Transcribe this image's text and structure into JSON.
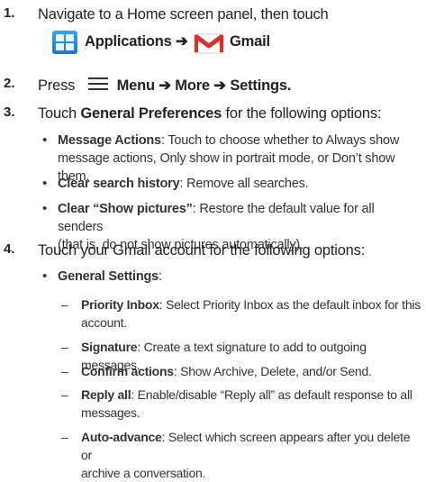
{
  "step1": {
    "num": "1.",
    "text": "Navigate to a Home screen panel, then touch",
    "applications": "Applications",
    "arrow": "➔",
    "gmail": "Gmail"
  },
  "step2": {
    "num": "2.",
    "press": "Press",
    "menu": "Menu",
    "arrow1": "➔",
    "more": "More",
    "arrow2": "➔",
    "settings": "Settings",
    "period": "."
  },
  "step3": {
    "num": "3.",
    "touch": "Touch",
    "general_preferences": "General Preferences",
    "rest": "for the following options:",
    "bullets": [
      {
        "title": "Message Actions",
        "text_l1": ": Touch to choose whether to Always show",
        "text_l2": "message actions, Only show in portrait mode, or Don’t show them."
      },
      {
        "title": "Clear search history",
        "text_l1": ": Remove all searches.",
        "text_l2": ""
      },
      {
        "title": "Clear “Show pictures”",
        "text_l1": ": Restore the default value for all senders",
        "text_l2": "(that is, do not show pictures automatically)."
      }
    ]
  },
  "step4": {
    "num": "4.",
    "text": "Touch your Gmail account for the following options:",
    "bullet": "General Settings",
    "colon": ":",
    "subs": [
      {
        "title": "Priority Inbox",
        "text_l1": ": Select Priority Inbox as the default inbox for this",
        "text_l2": "account."
      },
      {
        "title": "Signature",
        "text_l1": ": Create a text signature to add to outgoing messages.",
        "text_l2": ""
      },
      {
        "title": "Confirm actions",
        "text_l1": ": Show Archive, Delete, and/or Send.",
        "text_l2": ""
      },
      {
        "title": "Reply all",
        "text_l1": ": Enable/disable “Reply all” as default response to all",
        "text_l2": "messages."
      },
      {
        "title": "Auto-advance",
        "text_l1": ": Select which screen appears after you delete or",
        "text_l2": "archive a conversation."
      }
    ]
  },
  "symbols": {
    "bullet": "•",
    "dash": "–"
  },
  "icons": {
    "applications": "applications-grid-icon",
    "gmail": "gmail-envelope-icon",
    "menu": "menu-hardkey-icon"
  },
  "colors": {
    "text": "#222222",
    "apps_blue": "#1a78c9",
    "gmail_red": "#d6312a"
  }
}
